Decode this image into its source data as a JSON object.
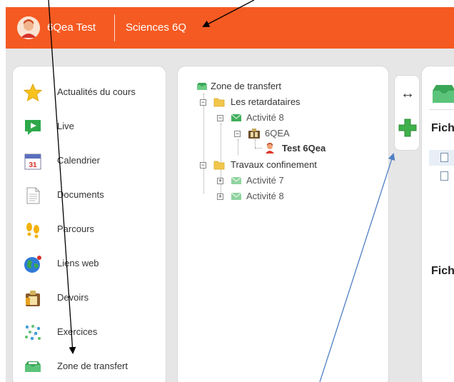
{
  "header": {
    "user_name": "6Qea Test",
    "course_name": "Sciences 6Q",
    "bar_color": "#f55a22"
  },
  "menu": {
    "items": [
      {
        "label": "Actualités du cours",
        "icon": "star-icon"
      },
      {
        "label": "Live",
        "icon": "live-chat-icon"
      },
      {
        "label": "Calendrier",
        "icon": "calendar-icon"
      },
      {
        "label": "Documents",
        "icon": "document-icon"
      },
      {
        "label": "Parcours",
        "icon": "footprints-icon"
      },
      {
        "label": "Liens web",
        "icon": "globe-icon"
      },
      {
        "label": "Devoirs",
        "icon": "homework-icon"
      },
      {
        "label": "Exercices",
        "icon": "exercises-icon"
      },
      {
        "label": "Zone de transfert",
        "icon": "transfer-tray-icon"
      }
    ],
    "calendar_day": "31"
  },
  "tree": {
    "root": "Zone de transfert",
    "folder1": "Les retardataires",
    "activity8a": "Activité 8",
    "group": "6QEA",
    "student": "Test 6Qea",
    "folder2": "Travaux confinement",
    "activity7": "Activité 7",
    "activity8b": "Activité 8",
    "toggle_minus": "−",
    "toggle_plus": "+"
  },
  "tools": {
    "resize_glyph": "↔",
    "add_glyph": "+"
  },
  "right_panel": {
    "heading1": "Fich",
    "heading2": "Fich"
  },
  "annotation_color_black": "#000000",
  "annotation_color_blue": "#4f7fc4"
}
